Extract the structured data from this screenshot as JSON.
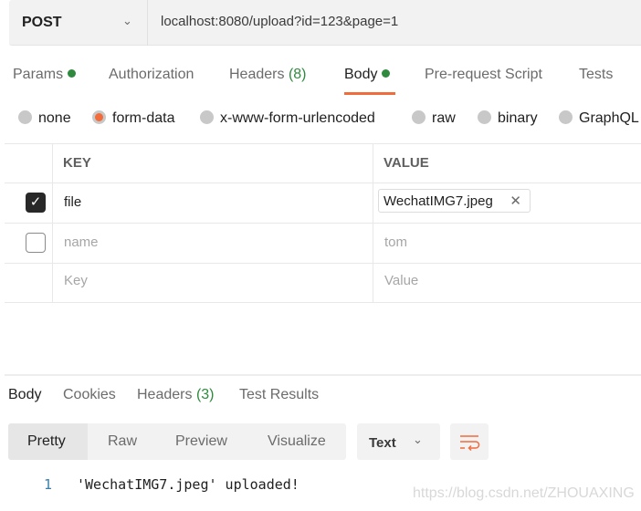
{
  "request": {
    "method": "POST",
    "url": "localhost:8080/upload?id=123&page=1"
  },
  "request_tabs": {
    "params": "Params",
    "authorization": "Authorization",
    "headers": "Headers",
    "headers_count": "(8)",
    "body": "Body",
    "prerequest": "Pre-request Script",
    "tests": "Tests"
  },
  "body_types": {
    "none": "none",
    "form_data": "form-data",
    "urlencoded": "x-www-form-urlencoded",
    "raw": "raw",
    "binary": "binary",
    "graphql": "GraphQL",
    "selected": "form-data"
  },
  "table": {
    "headers": [
      "KEY",
      "VALUE"
    ],
    "rows": [
      {
        "checked": true,
        "key": "file",
        "value": "WechatIMG7.jpeg"
      },
      {
        "checked": false,
        "key": "name",
        "value": "tom"
      }
    ],
    "placeholder": {
      "key": "Key",
      "value": "Value"
    }
  },
  "response_tabs": {
    "body": "Body",
    "cookies": "Cookies",
    "headers": "Headers",
    "headers_count": "(3)",
    "test_results": "Test Results"
  },
  "view_modes": {
    "pretty": "Pretty",
    "raw": "Raw",
    "preview": "Preview",
    "visualize": "Visualize",
    "format": "Text"
  },
  "response": {
    "line_number": "1",
    "line": "'WechatIMG7.jpeg' uploaded!"
  },
  "watermark": "https://blog.csdn.net/ZHOUAXING",
  "colors": {
    "accent": "#f26b3a",
    "green": "#2f8a3f"
  }
}
